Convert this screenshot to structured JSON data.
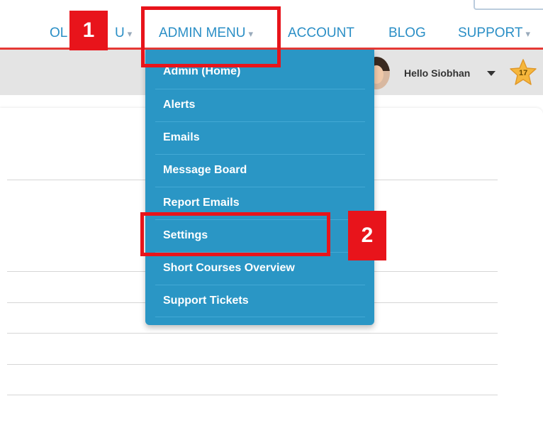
{
  "nav": {
    "items": [
      {
        "label": "OL",
        "caret": "▾"
      },
      {
        "label": "U",
        "caret": "▾"
      },
      {
        "label": "ADMIN MENU",
        "caret": "▾"
      },
      {
        "label": "ACCOUNT"
      },
      {
        "label": "BLOG"
      },
      {
        "label": "SUPPORT",
        "caret": "▾"
      }
    ]
  },
  "user": {
    "greeting": "Hello Siobhan",
    "badge_count": "17"
  },
  "dropdown": {
    "items": [
      "Admin (Home)",
      "Alerts",
      "Emails",
      "Message Board",
      "Report Emails",
      "Settings",
      "Short Courses Overview",
      "Support Tickets"
    ]
  },
  "annotations": {
    "step1": "1",
    "step2": "2"
  },
  "colors": {
    "nav_link": "#2b8fc6",
    "dropdown_bg": "#2a96c5",
    "accent_red": "#e53935",
    "annotation_red": "#e8141b"
  }
}
